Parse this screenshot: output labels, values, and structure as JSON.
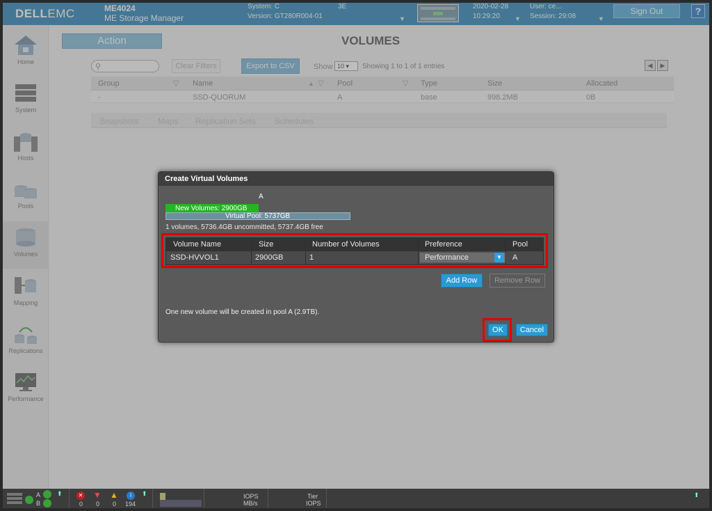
{
  "header": {
    "logo_bold": "DELL",
    "logo_thin": "EMC",
    "model": "ME4024",
    "product": "ME Storage Manager",
    "system": "System: C",
    "version": "Version: GT280R004-01",
    "health": "3E",
    "date": "2020-02-28",
    "time": "10:29:20",
    "user": "User: ce...",
    "session": "Session: 29:08",
    "sign_out": "Sign Out",
    "help": "?"
  },
  "sidebar": {
    "items": [
      {
        "label": "Home",
        "icon": "home-icon"
      },
      {
        "label": "System",
        "icon": "system-icon"
      },
      {
        "label": "Hosts",
        "icon": "hosts-icon"
      },
      {
        "label": "Pools",
        "icon": "pools-icon"
      },
      {
        "label": "Volumes",
        "icon": "volumes-icon"
      },
      {
        "label": "Mapping",
        "icon": "mapping-icon"
      },
      {
        "label": "Replications",
        "icon": "replications-icon"
      },
      {
        "label": "Performance",
        "icon": "performance-icon"
      }
    ],
    "active": "Volumes"
  },
  "main": {
    "action": "Action",
    "title": "VOLUMES",
    "clear_filters": "Clear Filters",
    "export_csv": "Export to CSV",
    "show_label": "Show",
    "show_value": "10",
    "showing": "Showing 1 to 1 of 1 entries",
    "table": {
      "columns": [
        "Group",
        "Name",
        "Pool",
        "Type",
        "Size",
        "Allocated"
      ],
      "rows": [
        [
          "-",
          "SSD-QUORUM",
          "A",
          "base",
          "998.2MB",
          "0B"
        ]
      ]
    },
    "subtabs": [
      "Snapshots",
      "Maps",
      "Replication Sets",
      "Schedules"
    ]
  },
  "dialog": {
    "title": "Create Virtual Volumes",
    "pool_letter": "A",
    "new_volumes_label": "New Volumes: 2900GB",
    "virtual_pool_label": "Virtual Pool: 5737GB",
    "new_volumes_fraction": 0.505,
    "summary": "1 volumes, 5736.4GB uncommitted, 5737.4GB free",
    "columns": [
      "Volume Name",
      "Size",
      "Number of Volumes",
      "Preference",
      "Pool"
    ],
    "row": {
      "name": "SSD-HVVOL1",
      "size": "2900GB",
      "count": "1",
      "preference": "Performance",
      "pool": "A"
    },
    "add_row": "Add Row",
    "remove_row": "Remove Row",
    "info": "One new volume will be created in pool A (2.9TB).",
    "ok": "OK",
    "cancel": "Cancel"
  },
  "footer": {
    "controller_a": "A",
    "controller_b": "B",
    "counts": [
      "0",
      "0",
      "0",
      "194"
    ],
    "iops_label": "IOPS",
    "mbs_label": "MB/s",
    "tier_label": "Tier",
    "tier_iops_label": "IOPS"
  },
  "colors": {
    "header_blue": "#1f7fb5",
    "accent_button": "#2a9ad4",
    "highlight_red": "#e00000",
    "bar_green": "#27b327"
  }
}
